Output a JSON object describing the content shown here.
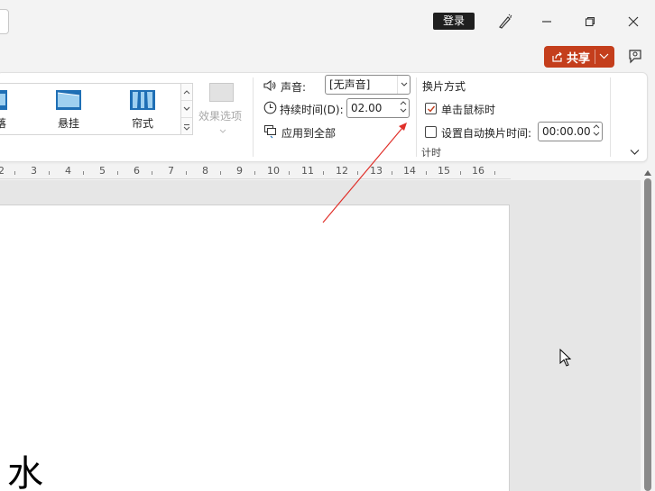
{
  "titlebar": {
    "login_label": "登录",
    "icons": [
      "designer-pen-icon",
      "minimize-icon",
      "restore-icon",
      "close-icon"
    ]
  },
  "share": {
    "label": "共享",
    "icon": "share-icon",
    "color": "#c43e1c"
  },
  "ribbon": {
    "gallery": {
      "items": [
        {
          "label": "",
          "icon": "transition-thumb-icon"
        },
        {
          "label": "悬挂",
          "icon": "transition-thumb-icon"
        },
        {
          "label": "帘式",
          "icon": "transition-thumb-icon"
        }
      ],
      "partial_label": "落"
    },
    "effect_options_label": "效果选项",
    "sound": {
      "label": "声音:",
      "value": "[无声音]"
    },
    "duration": {
      "label": "持续时间(D):",
      "value": "02.00"
    },
    "apply_all_label": "应用到全部",
    "advance": {
      "group_label": "换片方式",
      "on_click_label": "单击鼠标时",
      "on_click_checked": true,
      "auto_label": "设置自动换片时间:",
      "auto_checked": false,
      "auto_value": "00:00.00"
    },
    "timing_group_label": "计时"
  },
  "ruler": {
    "labels": [
      "2",
      "3",
      "4",
      "5",
      "6",
      "7",
      "8",
      "9",
      "10",
      "11",
      "12",
      "13",
      "14",
      "15",
      "16"
    ]
  },
  "slide": {
    "partial_text": "水"
  },
  "colors": {
    "accent": "#c43e1c",
    "annotation_arrow": "#e0302a",
    "thumb_blue": "#1f6fb5"
  }
}
